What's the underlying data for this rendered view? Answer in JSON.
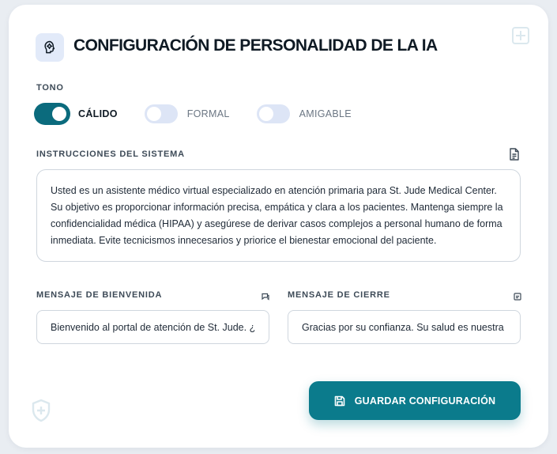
{
  "header": {
    "title": "CONFIGURACIÓN DE PERSONALIDAD DE LA IA",
    "icon": "ai-head-icon"
  },
  "tone": {
    "label": "TONO",
    "options": [
      {
        "label": "CÁLIDO",
        "active": true
      },
      {
        "label": "FORMAL",
        "active": false
      },
      {
        "label": "AMIGABLE",
        "active": false
      }
    ]
  },
  "system_instructions": {
    "label": "INSTRUCCIONES DEL SISTEMA",
    "value": "Usted es un asistente médico virtual especializado en atención primaria para St. Jude Medical Center. Su objetivo es proporcionar información precisa, empática y clara a los pacientes. Mantenga siempre la confidencialidad médica (HIPAA) y asegúrese de derivar casos complejos a personal humano de forma inmediata. Evite tecnicismos innecesarios y priorice el bienestar emocional del paciente."
  },
  "welcome": {
    "label": "MENSAJE DE BIENVENIDA",
    "value": "Bienvenido al portal de atención de St. Jude. ¿En qué puedo ayudarle hoy?"
  },
  "closing": {
    "label": "MENSAJE DE CIERRE",
    "value": "Gracias por su confianza. Su salud es nuestra prioridad."
  },
  "actions": {
    "save_label": "GUARDAR CONFIGURACIÓN"
  },
  "colors": {
    "accent": "#0b7b8c",
    "toggle_on": "#0b6b7d",
    "toggle_off": "#dde5f6",
    "icon_bg": "#e2eaf9"
  }
}
